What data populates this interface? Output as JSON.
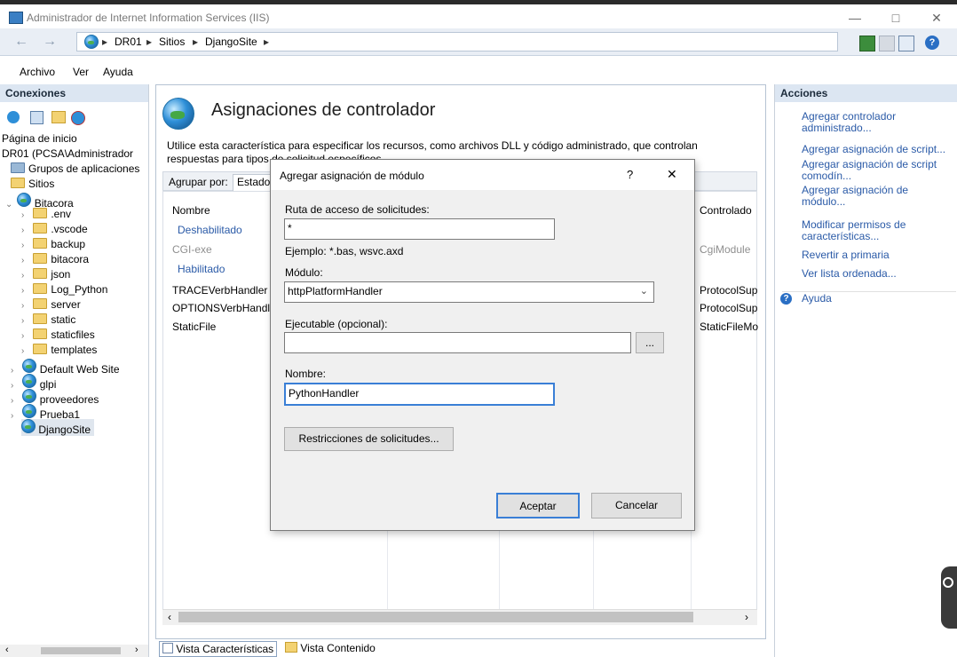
{
  "window": {
    "title": "Administrador de Internet Information Services (IIS)",
    "minimize": "—",
    "maximize": "□",
    "close": "✕"
  },
  "address": {
    "crumbs": [
      "DR01",
      "Sitios",
      "DjangoSite"
    ],
    "separator": "▸"
  },
  "menu": [
    "Archivo",
    "Ver",
    "Ayuda"
  ],
  "connections": {
    "header": "Conexiones",
    "items": [
      {
        "label": "Página de inicio"
      },
      {
        "label": "DR01 (PCSA\\Administrador"
      },
      {
        "label": "Grupos de aplicaciones"
      },
      {
        "label": "Sitios"
      },
      {
        "label": "Bitacora"
      },
      {
        "label": ".env"
      },
      {
        "label": ".vscode"
      },
      {
        "label": "backup"
      },
      {
        "label": "bitacora"
      },
      {
        "label": "json"
      },
      {
        "label": "Log_Python"
      },
      {
        "label": "server"
      },
      {
        "label": "static"
      },
      {
        "label": "staticfiles"
      },
      {
        "label": "templates"
      },
      {
        "label": "Default Web Site"
      },
      {
        "label": "glpi"
      },
      {
        "label": "proveedores"
      },
      {
        "label": "Prueba1"
      },
      {
        "label": "DjangoSite"
      }
    ]
  },
  "main": {
    "title": "Asignaciones de controlador",
    "description_line1": "Utilice esta característica para especificar los recursos, como archivos DLL y código administrado, que controlan",
    "description_line2": "respuestas para tipos de solicitud específicos.",
    "group_by_label": "Agrupar por:",
    "group_by_value": "Estado",
    "columns": {
      "name": "Nombre",
      "handler": "Controlado"
    },
    "group_disabled": "Deshabilitado",
    "group_enabled": "Habilitado",
    "rows": [
      {
        "name": "CGI-exe",
        "handler": "CgiModule"
      },
      {
        "name": "TRACEVerbHandler",
        "handler": "ProtocolSup"
      },
      {
        "name": "OPTIONSVerbHandl",
        "handler": "ProtocolSup"
      },
      {
        "name": "StaticFile",
        "handler": "StaticFileMo"
      }
    ],
    "tab_features": "Vista Características",
    "tab_content": "Vista Contenido"
  },
  "actions": {
    "header": "Acciones",
    "items": [
      "Agregar controlador administrado...",
      "Agregar asignación de script...",
      "Agregar asignación de script comodín...",
      "Agregar asignación de módulo...",
      "Modificar permisos de características...",
      "Revertir a primaria",
      "Ver lista ordenada..."
    ],
    "help": "Ayuda"
  },
  "dialog": {
    "title": "Agregar asignación de módulo",
    "help_btn": "?",
    "close_btn": "✕",
    "request_path_label": "Ruta de acceso de solicitudes:",
    "request_path_value": "*",
    "example": "Ejemplo: *.bas, wsvc.axd",
    "module_label": "Módulo:",
    "module_value": "httpPlatformHandler",
    "executable_label": "Ejecutable (opcional):",
    "executable_value": "",
    "browse_btn": "...",
    "name_label": "Nombre:",
    "name_value": "PythonHandler",
    "restrictions_btn": "Restricciones de solicitudes...",
    "ok_btn": "Aceptar",
    "cancel_btn": "Cancelar"
  }
}
